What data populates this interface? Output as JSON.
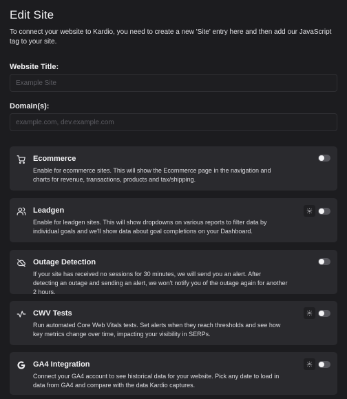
{
  "dialog": {
    "title": "Edit Site",
    "intro": "To connect your website to Kardio, you need to create a new 'Site' entry here and then add our JavaScript tag to your site."
  },
  "form": {
    "website_title": {
      "label": "Website Title:",
      "value": "",
      "placeholder": "Example Site"
    },
    "domains": {
      "label": "Domain(s):",
      "value": "",
      "placeholder": "example.com, dev.example.com"
    }
  },
  "features": [
    {
      "icon": "cart-icon",
      "title": "Ecommerce",
      "description": "Enable for ecommerce sites. This will show the Ecommerce page in the navigation and charts for revenue, transactions, products and tax/shipping.",
      "enabled": false,
      "has_settings": false
    },
    {
      "icon": "users-icon",
      "title": "Leadgen",
      "description": "Enable for leadgen sites. This will show dropdowns on various reports to filter data by individual goals and we'll show data about goal completions on your Dashboard.",
      "enabled": false,
      "has_settings": true
    },
    {
      "icon": "cloud-off-icon",
      "title": "Outage Detection",
      "description": "If your site has received no sessions for 30 minutes, we will send you an alert. After detecting an outage and sending an alert, we won't notify you of the outage again for another 2 hours.",
      "enabled": false,
      "has_settings": false
    },
    {
      "icon": "activity-icon",
      "title": "CWV Tests",
      "description": "Run automated Core Web Vitals tests. Set alerts when they reach thresholds and see how key metrics change over time, impacting your visibility in SERPs.",
      "enabled": false,
      "has_settings": true
    },
    {
      "icon": "google-g-icon",
      "title": "GA4 Integration",
      "description": "Connect your GA4 account to see historical data for your website. Pick any date to load in data from GA4 and compare with the data Kardio captures.",
      "enabled": false,
      "has_settings": true
    }
  ]
}
